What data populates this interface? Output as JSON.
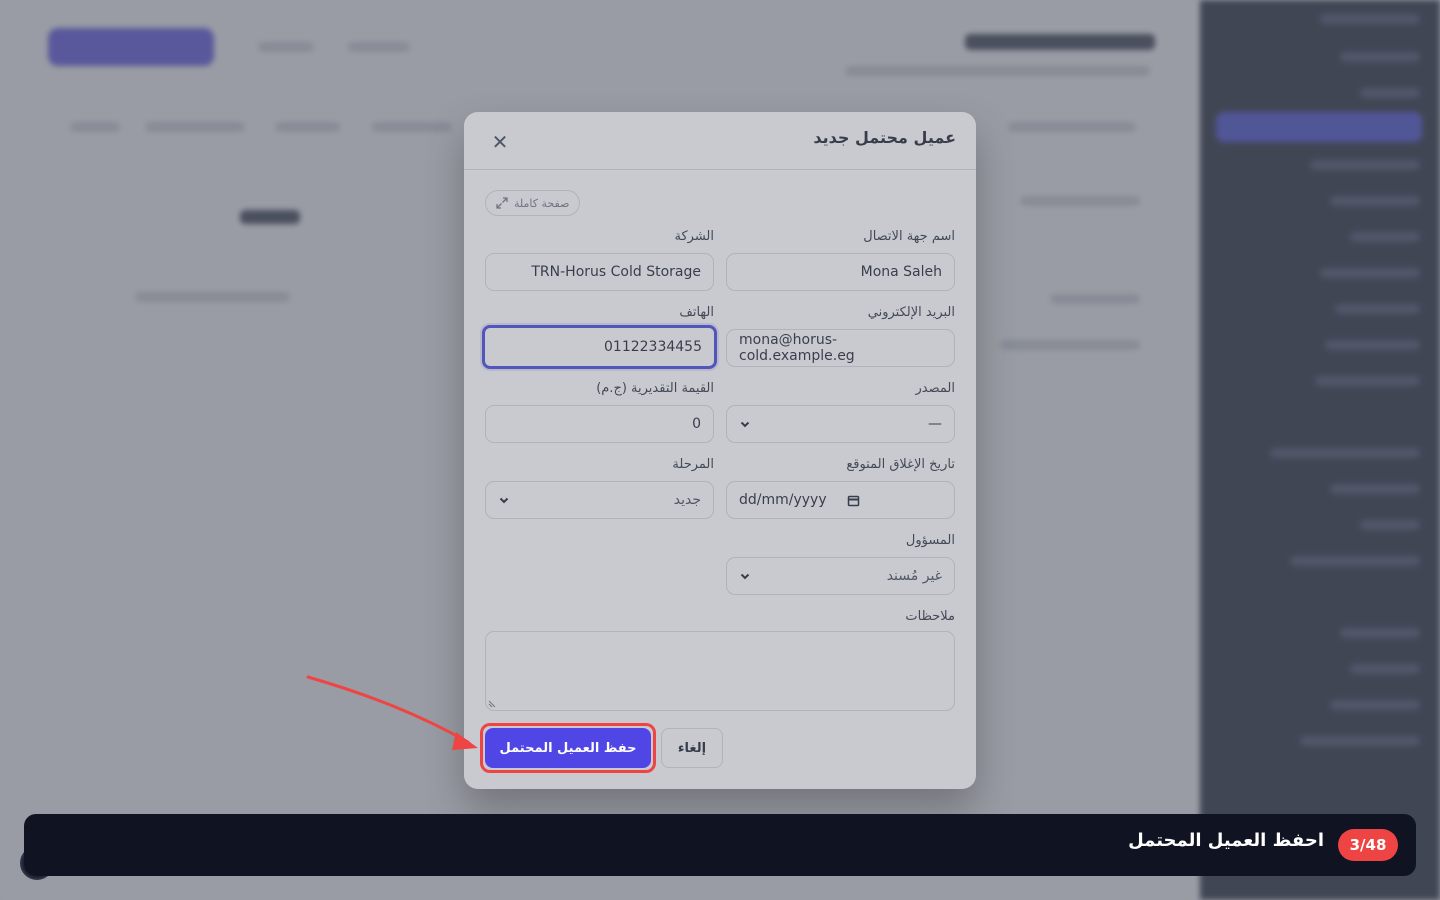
{
  "modal": {
    "title": "عميل محتمل جديد",
    "fullpage_label": "صفحة كاملة",
    "fields": {
      "contact_name": {
        "label": "اسم جهة الاتصال",
        "value": "Mona Saleh"
      },
      "company": {
        "label": "الشركة",
        "value": "TRN-Horus Cold Storage"
      },
      "email": {
        "label": "البريد الإلكتروني",
        "value": "mona@horus-cold.example.eg"
      },
      "phone": {
        "label": "الهاتف",
        "value": "01122334455"
      },
      "source": {
        "label": "المصدر",
        "value": "—"
      },
      "estimated_value": {
        "label": "القيمة التقديرية (ج.م)",
        "value": "0"
      },
      "expected_close": {
        "label": "تاريخ الإغلاق المتوقع",
        "placeholder": "dd/mm/yyyy"
      },
      "stage": {
        "label": "المرحلة",
        "value": "جديد"
      },
      "owner": {
        "label": "المسؤول",
        "value": "غير مُسند"
      },
      "notes": {
        "label": "ملاحظات",
        "value": ""
      }
    },
    "save_label": "حفظ العميل المحتمل",
    "cancel_label": "إلغاء"
  },
  "tour": {
    "step": "3/48",
    "title": "احفظ العميل المحتمل",
    "accent": "#ef4444"
  },
  "colors": {
    "primary": "#4f46e5",
    "focus_ring": "#3b3fd8",
    "highlight": "#ef4444",
    "sidebar": "#12172b"
  }
}
